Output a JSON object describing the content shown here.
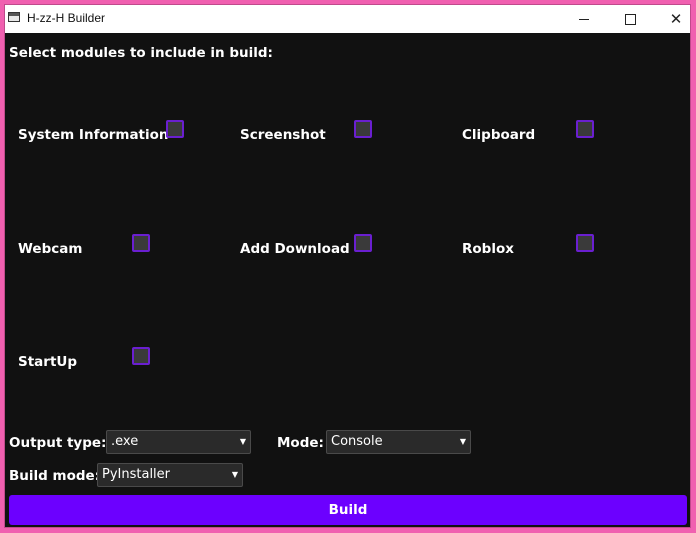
{
  "window": {
    "title": "H-zz-H Builder"
  },
  "heading": "Select modules to include in build:",
  "modules": [
    {
      "label": "System Information",
      "checked": false
    },
    {
      "label": "Screenshot",
      "checked": false
    },
    {
      "label": "Clipboard",
      "checked": false
    },
    {
      "label": "Webcam",
      "checked": false
    },
    {
      "label": "Add Download",
      "checked": false
    },
    {
      "label": "Roblox",
      "checked": false
    },
    {
      "label": "StartUp",
      "checked": false
    }
  ],
  "output_type": {
    "label": "Output type:",
    "value": ".exe"
  },
  "mode": {
    "label": "Mode:",
    "value": "Console"
  },
  "build_mode": {
    "label": "Build mode:",
    "value": "PyInstaller"
  },
  "build_button": "Build",
  "colors": {
    "accent": "#6c00ff",
    "checkbox_border": "#6a1fd0",
    "background": "#111111",
    "frame": "#f060b0"
  }
}
